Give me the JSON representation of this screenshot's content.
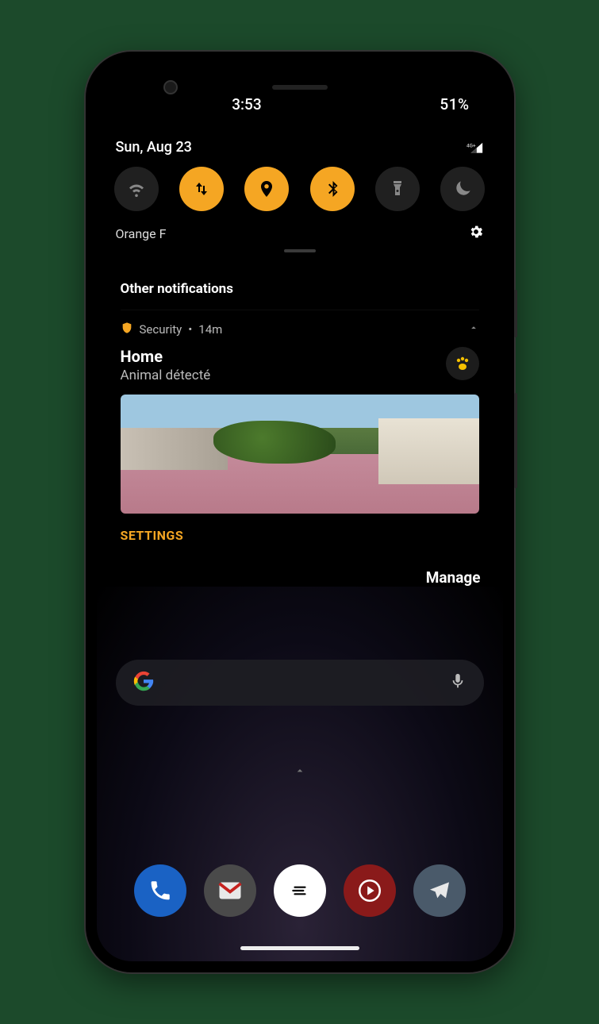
{
  "status": {
    "time": "3:53",
    "battery": "51%",
    "date": "Sun, Aug 23",
    "signal_label": "4G+"
  },
  "quick_settings": {
    "wifi": {
      "icon": "wifi-icon",
      "on": false
    },
    "data": {
      "icon": "data-arrows-icon",
      "on": true
    },
    "location": {
      "icon": "location-pin-icon",
      "on": true
    },
    "bluetooth": {
      "icon": "bluetooth-icon",
      "on": true
    },
    "flashlight": {
      "icon": "flashlight-icon",
      "on": false
    },
    "dnd": {
      "icon": "do-not-disturb-icon",
      "on": false
    }
  },
  "carrier": {
    "name": "Orange F",
    "settings_icon": "gear-icon"
  },
  "notifications": {
    "section_title": "Other notifications",
    "items": [
      {
        "app_icon": "shield-icon",
        "app_name": "Security",
        "age": "14m",
        "title": "Home",
        "subtitle": "Animal détecté",
        "badge_icon": "paw-icon",
        "action_label": "SETTINGS"
      }
    ],
    "manage_label": "Manage"
  },
  "dock": {
    "apps": [
      "phone",
      "gmail",
      "app-drawer",
      "youtube-music",
      "telegram"
    ]
  },
  "search": {
    "logo": "google-logo",
    "mic_icon": "microphone-icon"
  },
  "colors": {
    "accent": "#f5a623",
    "paw": "#f5c000"
  }
}
